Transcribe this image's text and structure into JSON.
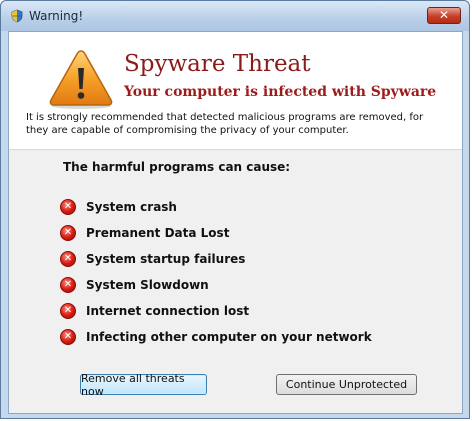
{
  "window": {
    "title": "Warning!",
    "close_label": "✕"
  },
  "header": {
    "title": "Spyware Threat",
    "subtitle": "Your computer is infected with Spyware",
    "description": "It is strongly recommended that detected malicious programs are removed, for they are capable of compromising the privacy of your computer."
  },
  "threats": {
    "heading": "The harmful programs can cause:",
    "items": [
      {
        "label": "System crash"
      },
      {
        "label": "Premanent Data Lost"
      },
      {
        "label": "System startup failures"
      },
      {
        "label": "System Slowdown"
      },
      {
        "label": "Internet connection lost"
      },
      {
        "label": "Infecting other computer on your network"
      }
    ],
    "item_icon": "error-x-icon",
    "icon_glyph": "✕"
  },
  "buttons": {
    "remove_label": "Remove all threats now",
    "continue_label": "Continue Unprotected"
  },
  "colors": {
    "title_red": "#8b1a1a",
    "error_red": "#d21a10",
    "warning_orange": "#f29a1c"
  }
}
